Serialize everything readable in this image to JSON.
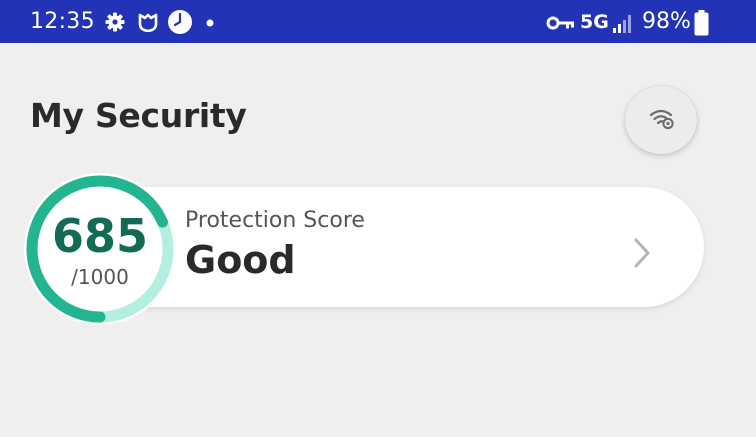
{
  "status_bar": {
    "time": "12:35",
    "network": "5G",
    "battery": "98%",
    "icons": [
      "gear-icon",
      "shield-notification-icon",
      "clock-icon",
      "dot-icon",
      "key-icon",
      "signal-icon",
      "battery-icon"
    ]
  },
  "header": {
    "title": "My Security",
    "wifi_button_icon": "wifi-security-icon"
  },
  "score_card": {
    "score": "685",
    "max": "/1000",
    "score_fraction": 0.685,
    "label": "Protection Score",
    "rating": "Good",
    "chevron_icon": "chevron-right-icon"
  },
  "colors": {
    "status_bar": "#2233b8",
    "background": "#efefef",
    "ring_filled": "#22b58f",
    "ring_track": "#b2efe0",
    "score_text": "#136b55"
  }
}
